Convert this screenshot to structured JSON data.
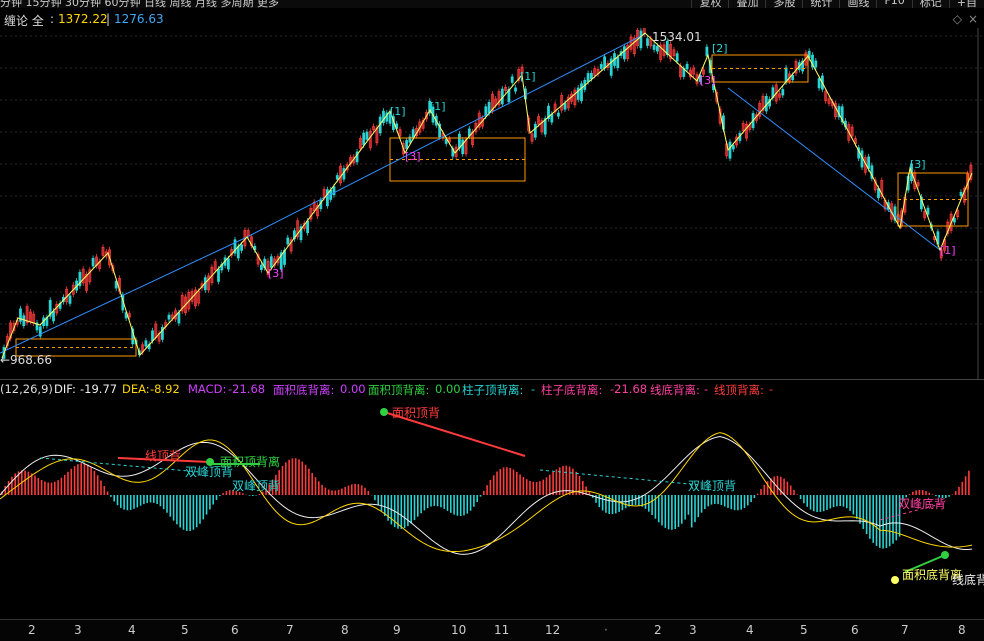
{
  "top_bar": {
    "periods": "分钟  15分钟  30分钟  60分钟  日线  周线  月线  多周期  更多",
    "buttons": [
      "复权",
      "叠加",
      "多股",
      "统计",
      "画线",
      "F10",
      "标记",
      "+自"
    ]
  },
  "indicator": {
    "name": "缠论 全",
    "val1": "1372.22",
    "val2": "1276.63",
    "val1_color": "#ffd700",
    "val2_color": "#3fa9f5"
  },
  "price_labels": {
    "high": "1534.01",
    "low": "968.66"
  },
  "markers": [
    "[1]",
    "[3]",
    "[1]",
    "[3]",
    "[1]",
    "[2]",
    "[3]",
    "[3]",
    "[1]",
    "[3]"
  ],
  "macd_bar": {
    "params": "(12,26,9)",
    "dif_label": "DIF:",
    "dif_value": "-19.77",
    "dea_label": "DEA:",
    "dea_value": "-8.92",
    "macd_label": "MACD:",
    "macd_value": "-21.68",
    "area_bottom": "面积底背离:",
    "area_bottom_value": "0.00",
    "area_top": "面积顶背离:",
    "area_top_value": "0.00",
    "bar_top": "柱子顶背离:",
    "bar_top_value": "-",
    "bar_bottom": "柱子底背离:",
    "bar_bottom_value": "-21.68",
    "line_bottom": "线底背离:",
    "line_bottom_value": "-",
    "line_top": "线顶背离:",
    "line_top_value": "-"
  },
  "sub_labels": {
    "line_top1": "线顶背",
    "double_top1": "双峰顶背",
    "area_top1": "面积顶背离",
    "double_top2": "双峰顶背",
    "area_top2": "面积顶背",
    "double_top3": "双峰顶背",
    "double_bottom": "双峰底背",
    "area_bottom": "面积底背离",
    "line_bottom": "线底背"
  },
  "x_axis": [
    "2",
    "3",
    "4",
    "5",
    "6",
    "7",
    "8",
    "9",
    "10",
    "11",
    "12",
    "2",
    "3",
    "4",
    "5",
    "6",
    "7",
    "8"
  ],
  "colors": {
    "up": "#ff3b3b",
    "down": "#28d4d4",
    "zigzag": "#ffff66",
    "trend": "#2f8fff",
    "box": "#ff9900"
  }
}
